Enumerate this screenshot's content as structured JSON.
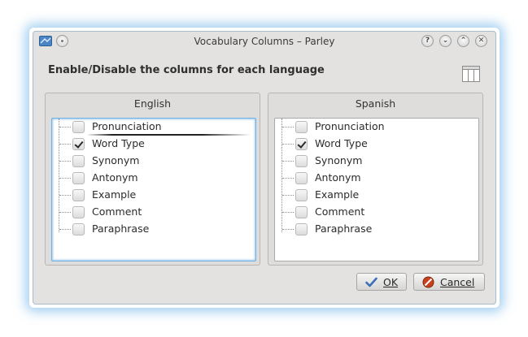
{
  "window": {
    "title": "Vocabulary Columns – Parley",
    "buttons": [
      "?",
      "⌄",
      "⌃",
      "✕"
    ]
  },
  "heading": "Enable/Disable the columns for each language",
  "columns_icon": "columns-layout-icon",
  "languages": [
    {
      "name": "English",
      "items": [
        {
          "label": "Pronunciation",
          "checked": false
        },
        {
          "label": "Word Type",
          "checked": true
        },
        {
          "label": "Synonym",
          "checked": false
        },
        {
          "label": "Antonym",
          "checked": false
        },
        {
          "label": "Example",
          "checked": false
        },
        {
          "label": "Comment",
          "checked": false
        },
        {
          "label": "Paraphrase",
          "checked": false
        }
      ]
    },
    {
      "name": "Spanish",
      "items": [
        {
          "label": "Pronunciation",
          "checked": false
        },
        {
          "label": "Word Type",
          "checked": true
        },
        {
          "label": "Synonym",
          "checked": false
        },
        {
          "label": "Antonym",
          "checked": false
        },
        {
          "label": "Example",
          "checked": false
        },
        {
          "label": "Comment",
          "checked": false
        },
        {
          "label": "Paraphrase",
          "checked": false
        }
      ]
    }
  ],
  "actions": {
    "ok_label": "OK",
    "ok_icon": "checkmark-icon",
    "cancel_label": "Cancel",
    "cancel_icon": "cancel-icon"
  },
  "colors": {
    "accent": "#6fb2e3",
    "window_bg": "#e3e2e1"
  }
}
